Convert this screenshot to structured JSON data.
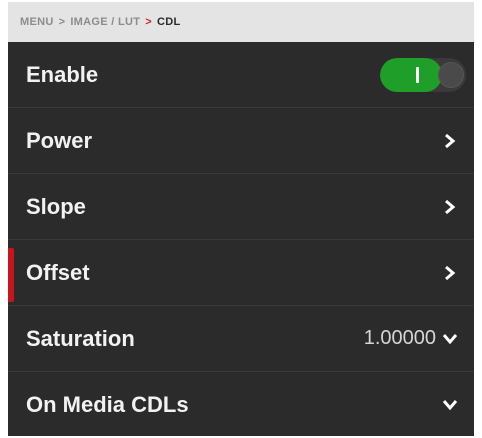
{
  "breadcrumb": {
    "items": [
      "MENU",
      "IMAGE / LUT",
      "CDL"
    ],
    "separator": ">"
  },
  "menu": {
    "items": [
      {
        "label": "Enable",
        "control": "toggle",
        "toggle_state": "on"
      },
      {
        "label": "Power",
        "control": "chevron-right"
      },
      {
        "label": "Slope",
        "control": "chevron-right"
      },
      {
        "label": "Offset",
        "control": "chevron-right",
        "selected": true
      },
      {
        "label": "Saturation",
        "value": "1.00000",
        "control": "chevron-down"
      },
      {
        "label": "On Media CDLs",
        "control": "chevron-down"
      }
    ]
  },
  "colors": {
    "background": "#2b2b2b",
    "breadcrumb_bg": "#e4e4e4",
    "accent_red": "#c8141c",
    "toggle_green": "#1f9e2a",
    "text": "#f2f2f2"
  }
}
